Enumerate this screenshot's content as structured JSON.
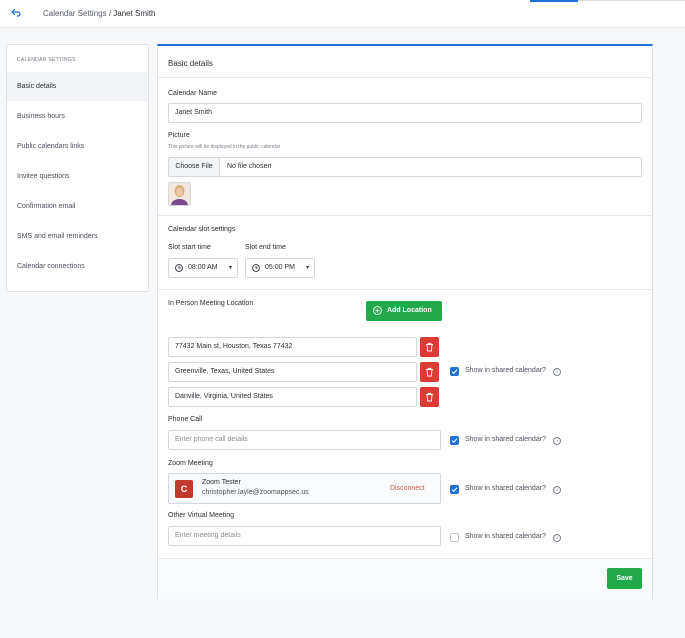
{
  "header": {
    "breadcrumb_parent": "Calendar Settings",
    "breadcrumb_separator": " / ",
    "breadcrumb_current": "Janet Smith"
  },
  "sidebar": {
    "title": "CALENDAR SETTINGS",
    "items": [
      {
        "label": "Basic details",
        "active": true
      },
      {
        "label": "Business hours"
      },
      {
        "label": "Public calendars links"
      },
      {
        "label": "Invitee questions"
      },
      {
        "label": "Confirmation email"
      },
      {
        "label": "SMS and email reminders"
      },
      {
        "label": "Calendar connections"
      }
    ]
  },
  "panel": {
    "title": "Basic details",
    "calendar_name": {
      "label": "Calendar Name",
      "value": "Janet Smith"
    },
    "picture": {
      "label": "Picture",
      "hint": "This picture will be displayed in the public calendar",
      "button": "Choose File",
      "status": "No file chosen"
    },
    "slots": {
      "title": "Calendar slot settings",
      "start_label": "Slot start time",
      "start_value": "08:00 AM",
      "end_label": "Slot end time",
      "end_value": "05:00 PM"
    },
    "in_person": {
      "label": "In Person Meeting Location",
      "add_button": "Add Location",
      "locations": [
        "77432 Main st, Houston, Texas 77432",
        "Greenville, Texas, United States",
        "Danville, Virginia, United States"
      ],
      "show_label": "Show in shared calendar?",
      "show_checked": true
    },
    "phone": {
      "label": "Phone Call",
      "placeholder": "Enter phone call details",
      "show_label": "Show in shared calendar?",
      "show_checked": true
    },
    "zoom": {
      "label": "Zoom Meeting",
      "logo_letter": "C",
      "account_name": "Zoom Tester",
      "account_email": "christopher.layle@zoomappsec.us",
      "disconnect": "Disconnect",
      "show_label": "Show in shared calendar?",
      "show_checked": true
    },
    "virtual": {
      "label": "Other Virtual Meeting",
      "placeholder": "Enter meeting details",
      "show_label": "Show in shared calendar?",
      "show_checked": false
    },
    "save": "Save"
  },
  "colors": {
    "accent": "#1f6fd8",
    "green": "#22a94a",
    "danger": "#dc3a35"
  }
}
